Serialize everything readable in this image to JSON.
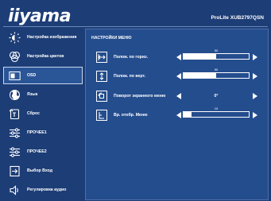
{
  "brand": {
    "logo_text": "iiyama",
    "model": "ProLite XUB2797QSN"
  },
  "sidebar": {
    "items": [
      {
        "label": "Настройка изображения",
        "icon": "picture-adjust-icon"
      },
      {
        "label": "Настройка цветов",
        "icon": "color-settings-icon"
      },
      {
        "label": "OSD",
        "icon": "osd-icon",
        "active": true
      },
      {
        "label": "Язык",
        "icon": "language-globe-icon"
      },
      {
        "label": "Сброс",
        "icon": "reset-icon"
      },
      {
        "label": "ПРОЧЕЕ1",
        "icon": "misc1-icon"
      },
      {
        "label": "ПРОЧЕЕ2",
        "icon": "misc2-icon"
      },
      {
        "label": "Выбор Вход",
        "icon": "input-select-icon"
      },
      {
        "label": "Регулировка аудио",
        "icon": "audio-icon"
      }
    ]
  },
  "panel": {
    "title": "НАСТРОЙКИ МЕНЮ",
    "rows": [
      {
        "label": "Полож. по гориз.",
        "icon": "horizontal-position-icon",
        "value": "50",
        "level": 0.5
      },
      {
        "label": "Полож. по верт.",
        "icon": "vertical-position-icon",
        "value": "50",
        "level": 0.5
      },
      {
        "label": "Поворот экранного меню",
        "icon": "osd-rotation-icon",
        "value": "0°"
      },
      {
        "label": "Вр. отобр. Меню",
        "icon": "menu-timer-icon",
        "value": "10",
        "level": 0.12
      }
    ]
  },
  "colors": {
    "background": "#1d3d76",
    "panel": "#244d8e",
    "active_item": "#2a5597",
    "text": "#ffffff"
  }
}
